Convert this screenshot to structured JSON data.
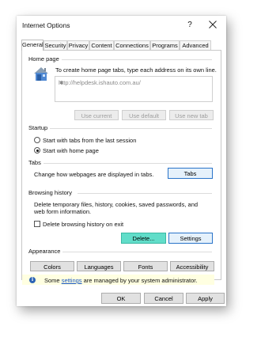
{
  "window": {
    "title": "Internet Options",
    "help_glyph": "?",
    "close_glyph": "×"
  },
  "tabs": [
    {
      "label": "General",
      "active": true
    },
    {
      "label": "Security"
    },
    {
      "label": "Privacy"
    },
    {
      "label": "Content"
    },
    {
      "label": "Connections"
    },
    {
      "label": "Programs"
    },
    {
      "label": "Advanced"
    }
  ],
  "home_page": {
    "group_label": "Home page",
    "instruction": "To create home page tabs, type each address on its own line.",
    "address": "http://helpdesk.ishauto.com.au/",
    "icon": "house-icon",
    "buttons": {
      "use_current": "Use current",
      "use_default": "Use default",
      "use_new_tab": "Use new tab"
    }
  },
  "startup": {
    "group_label": "Startup",
    "option_tabs": "Start with tabs from the last session",
    "option_home": "Start with home page",
    "selected": "option_home"
  },
  "tabs_group": {
    "group_label": "Tabs",
    "description": "Change how webpages are displayed in tabs.",
    "button": "Tabs"
  },
  "browsing_history": {
    "group_label": "Browsing history",
    "description_line1": "Delete temporary files, history, cookies, saved passwords, and",
    "description_line2": "web form information.",
    "checkbox_label": "Delete browsing history on exit",
    "checkbox_checked": false,
    "delete_button": "Delete...",
    "settings_button": "Settings"
  },
  "appearance": {
    "group_label": "Appearance",
    "buttons": {
      "colors": "Colors",
      "languages": "Languages",
      "fonts": "Fonts",
      "accessibility": "Accessibility"
    }
  },
  "notice": {
    "prefix": "Some ",
    "link": "settings",
    "suffix": " are managed by your system administrator.",
    "icon": "info-icon"
  },
  "footer": {
    "ok": "OK",
    "cancel": "Cancel",
    "apply": "Apply"
  },
  "colors": {
    "accent_button": "#61ddc9",
    "info_bar": "#ffffe1",
    "link": "#1a56c4"
  }
}
